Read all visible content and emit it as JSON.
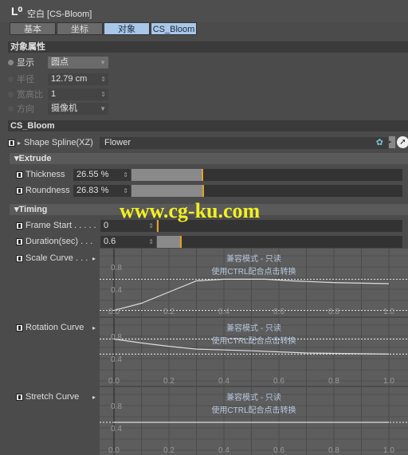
{
  "title": "空白 [CS-Bloom]",
  "tabs": [
    {
      "label": "基本"
    },
    {
      "label": "坐标"
    },
    {
      "label": "对象"
    },
    {
      "label": "CS_Bloom"
    }
  ],
  "object_props": {
    "header": "对象属性",
    "display_label": "显示",
    "display_value": "圆点",
    "radius_label": "半径",
    "radius_value": "12.79 cm",
    "aspect_label": "宽高比",
    "aspect_value": "1",
    "orient_label": "方向",
    "orient_value": "摄像机"
  },
  "cs_bloom": {
    "header": "CS_Bloom",
    "shape_label": "Shape Spline(XZ)",
    "shape_value": "Flower",
    "extrude": {
      "header": "Extrude",
      "thickness_label": "Thickness",
      "thickness_value": "26.55 %",
      "thickness_pct": 26.55,
      "roundness_label": "Roundness",
      "roundness_value": "26.83 %",
      "roundness_pct": 26.83
    },
    "timing": {
      "header": "Timing",
      "frame_label": "Frame Start . . . . .",
      "frame_value": "0",
      "duration_label": "Duration(sec) . . .",
      "duration_value": "0.6",
      "duration_pct": 10
    }
  },
  "curves": {
    "readonly": "兼容模式 - 只读",
    "hint": "使用CTRL配合点击转换",
    "x_ticks": [
      "0.0",
      "0.2",
      "0.4",
      "0.6",
      "0.8",
      "1.0"
    ],
    "y_ticks": [
      "0.4",
      "0.8"
    ],
    "items": [
      {
        "label": "Scale Curve . . .",
        "points": [
          [
            0,
            0.02
          ],
          [
            0.1,
            0.15
          ],
          [
            0.2,
            0.35
          ],
          [
            0.3,
            0.55
          ],
          [
            0.4,
            0.58
          ],
          [
            0.55,
            0.58
          ],
          [
            0.65,
            0.55
          ],
          [
            0.8,
            0.52
          ],
          [
            1.0,
            0.5
          ]
        ]
      },
      {
        "label": "Rotation Curve",
        "points": [
          [
            0,
            0.75
          ],
          [
            0.1,
            0.68
          ],
          [
            0.2,
            0.62
          ],
          [
            0.3,
            0.57
          ],
          [
            0.5,
            0.54
          ],
          [
            0.7,
            0.5
          ],
          [
            1.0,
            0.48
          ]
        ]
      },
      {
        "label": "Stretch Curve",
        "points": [
          [
            0,
            0.5
          ],
          [
            1.0,
            0.5
          ]
        ]
      }
    ]
  },
  "watermark": "www.cg-ku.com",
  "colors": {
    "accent": "#e8a020",
    "tab_active": "#a9c7e8"
  }
}
